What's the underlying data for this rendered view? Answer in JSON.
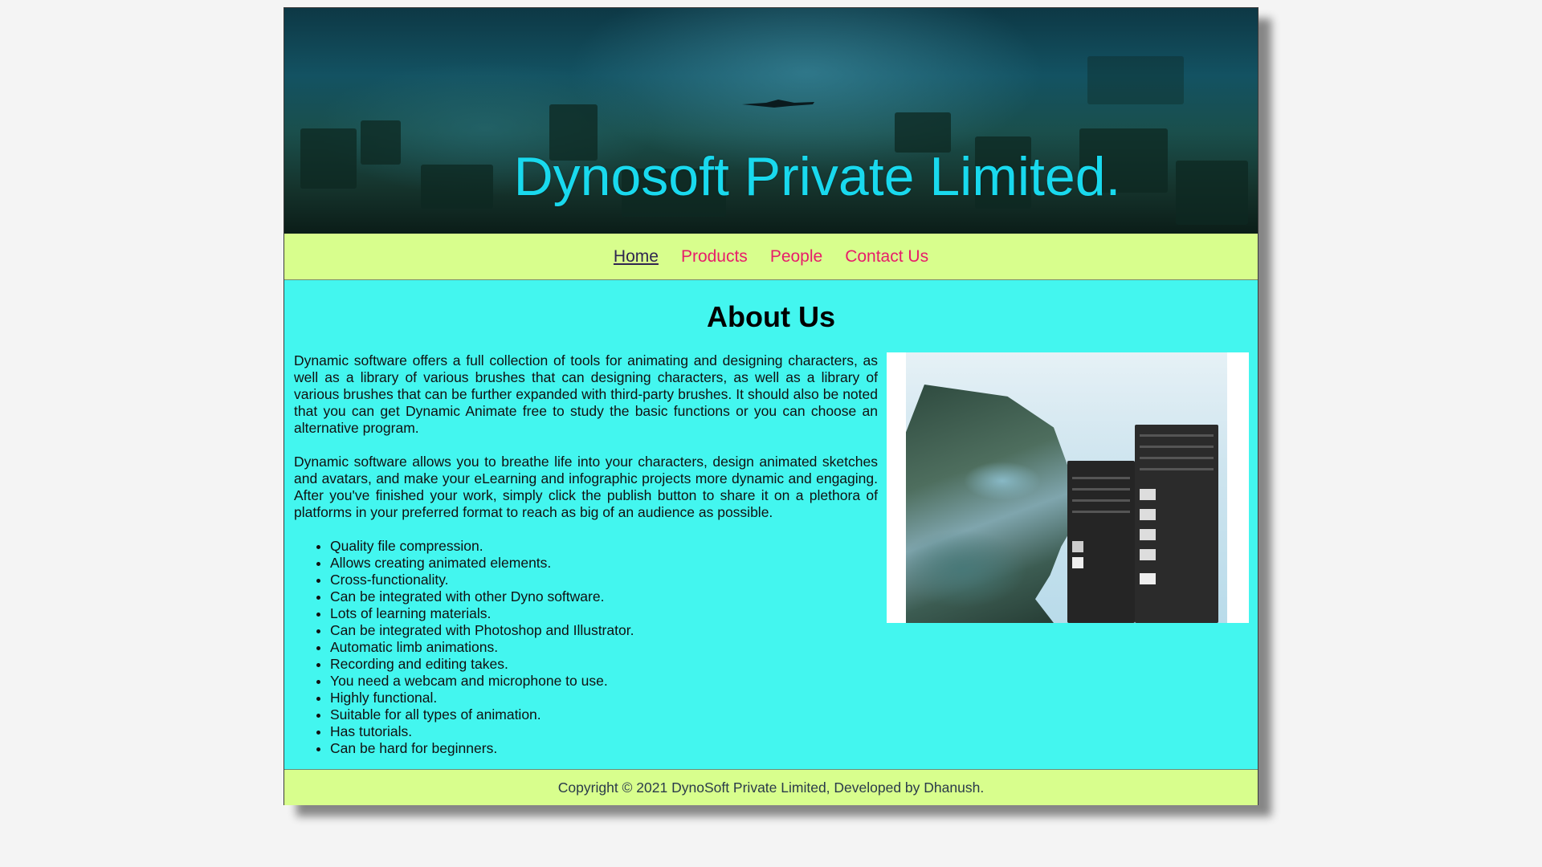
{
  "header": {
    "title": "Dynosoft Private Limited."
  },
  "nav": {
    "items": [
      {
        "label": "Home",
        "active": true
      },
      {
        "label": "Products",
        "active": false
      },
      {
        "label": "People",
        "active": false
      },
      {
        "label": "Contact Us",
        "active": false
      }
    ]
  },
  "main": {
    "heading": "About Us",
    "paragraphs": [
      "Dynamic software offers a full collection of tools for animating and designing characters, as well as a library of various brushes that can designing characters, as well as a library of various brushes that can be further expanded with third-party brushes. It should also be noted that you can get Dynamic Animate free to study the basic functions or you can choose an alternative program.",
      "Dynamic software allows you to breathe life into your characters, design animated sketches and avatars, and make your eLearning and infographic projects more dynamic and engaging. After you've finished your work, simply click the publish button to share it on a plethora of platforms in your preferred format to reach as big of an audience as possible."
    ],
    "features": [
      "Quality file compression.",
      "Allows creating animated elements.",
      "Cross-functionality.",
      "Can be integrated with other Dyno software.",
      "Lots of learning materials.",
      "Can be integrated with Photoshop and Illustrator.",
      "Automatic limb animations.",
      "Recording and editing takes.",
      "You need a webcam and microphone to use.",
      "Highly functional.",
      "Suitable for all types of animation.",
      "Has tutorials.",
      "Can be hard for beginners."
    ]
  },
  "footer": {
    "text": "Copyright © 2021 DynoSoft Private Limited, Developed by Dhanush."
  },
  "colors": {
    "title": "#19d9ee",
    "nav_bg": "#d8fe8d",
    "nav_link": "#e81c6a",
    "nav_active": "#2f2550",
    "content_bg": "#43f6ef"
  }
}
